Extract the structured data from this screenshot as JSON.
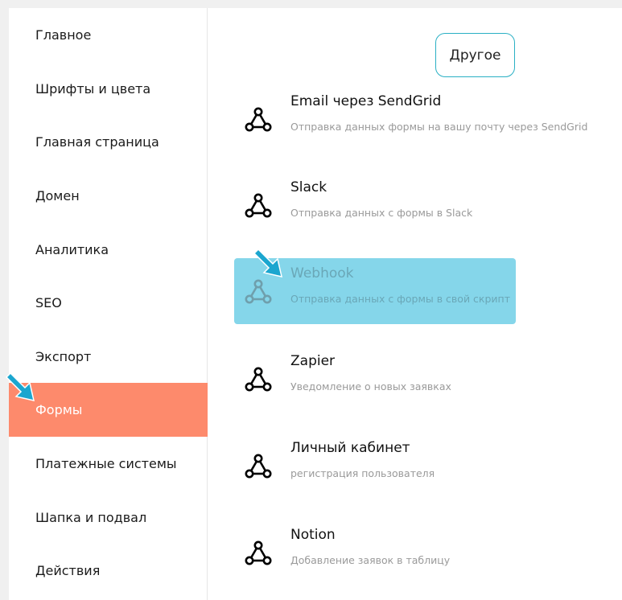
{
  "sidebar": {
    "items": [
      {
        "label": "Главное"
      },
      {
        "label": "Шрифты и цвета"
      },
      {
        "label": "Главная страница"
      },
      {
        "label": "Домен"
      },
      {
        "label": "Аналитика"
      },
      {
        "label": "SEO"
      },
      {
        "label": "Экспорт"
      },
      {
        "label": "Формы"
      },
      {
        "label": "Платежные системы"
      },
      {
        "label": "Шапка и подвал"
      },
      {
        "label": "Действия"
      }
    ],
    "active_index": 7
  },
  "main": {
    "category_button": "Другое",
    "integrations": [
      {
        "title": "Email через SendGrid",
        "description": "Отправка данных формы на вашу почту через SendGrid",
        "icon": "integration-nodes-icon"
      },
      {
        "title": "Slack",
        "description": "Отправка данных с формы в Slack",
        "icon": "integration-nodes-icon"
      },
      {
        "title": "Webhook",
        "description": "Отправка данных с формы в свой скрипт",
        "icon": "integration-nodes-icon",
        "highlighted": true
      },
      {
        "title": "Zapier",
        "description": "Уведомление о новых заявках",
        "icon": "integration-nodes-icon"
      },
      {
        "title": "Личный кабинет",
        "description": "регистрация пользователя",
        "icon": "integration-nodes-icon"
      },
      {
        "title": "Notion",
        "description": "Добавление заявок в таблицу",
        "icon": "integration-nodes-icon"
      }
    ]
  },
  "colors": {
    "active_sidebar": "#fd8a6c",
    "highlight": "#85d6ea",
    "accent_border": "#2ab0c4",
    "pointer_arrow": "#1ba6cf"
  }
}
